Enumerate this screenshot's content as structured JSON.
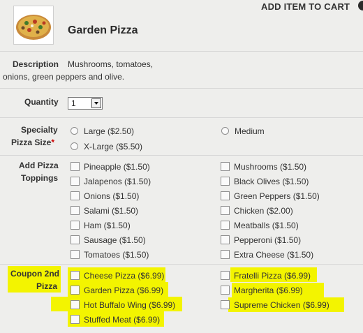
{
  "header": {
    "add_to_cart": "ADD ITEM TO CART",
    "product_name": "Garden Pizza",
    "thumbnail_icon": "pizza-thumbnail"
  },
  "description": {
    "label": "Description",
    "text_line1": "Mushrooms, tomatoes,",
    "text_line2": "onions, green peppers and olive."
  },
  "quantity": {
    "label": "Quantity",
    "value": "1"
  },
  "size": {
    "label_line1": "Specialty",
    "label_line2": "Pizza Size",
    "required_mark": "*",
    "options": [
      {
        "label": "Large ($2.50)"
      },
      {
        "label": "Medium"
      },
      {
        "label": "X-Large ($5.50)"
      }
    ]
  },
  "toppings": {
    "label_line1": "Add Pizza",
    "label_line2": "Toppings",
    "left": [
      {
        "label": "Pineapple ($1.50)"
      },
      {
        "label": "Jalapenos ($1.50)"
      },
      {
        "label": "Onions ($1.50)"
      },
      {
        "label": "Salami ($1.50)"
      },
      {
        "label": "Ham ($1.50)"
      },
      {
        "label": "Sausage ($1.50)"
      },
      {
        "label": "Tomatoes ($1.50)"
      }
    ],
    "right": [
      {
        "label": "Mushrooms ($1.50)"
      },
      {
        "label": "Black Olives ($1.50)"
      },
      {
        "label": "Green Peppers ($1.50)"
      },
      {
        "label": "Chicken ($2.00)"
      },
      {
        "label": "Meatballs ($1.50)"
      },
      {
        "label": "Pepperoni ($1.50)"
      },
      {
        "label": "Extra Cheese ($1.50)"
      }
    ]
  },
  "coupon": {
    "label_line1": "Coupon 2nd",
    "label_line2": "Pizza",
    "highlight_color": "#f3f400",
    "left": [
      {
        "label": "Cheese Pizza ($6.99)"
      },
      {
        "label": "Garden Pizza ($6.99)"
      },
      {
        "label": "Hot Buffalo Wing ($6.99)"
      },
      {
        "label": "Stuffed Meat ($6.99)"
      }
    ],
    "right": [
      {
        "label": "Fratelli Pizza ($6.99)"
      },
      {
        "label": "Margherita ($6.99)"
      },
      {
        "label": "Supreme Chicken ($6.99)"
      }
    ]
  }
}
